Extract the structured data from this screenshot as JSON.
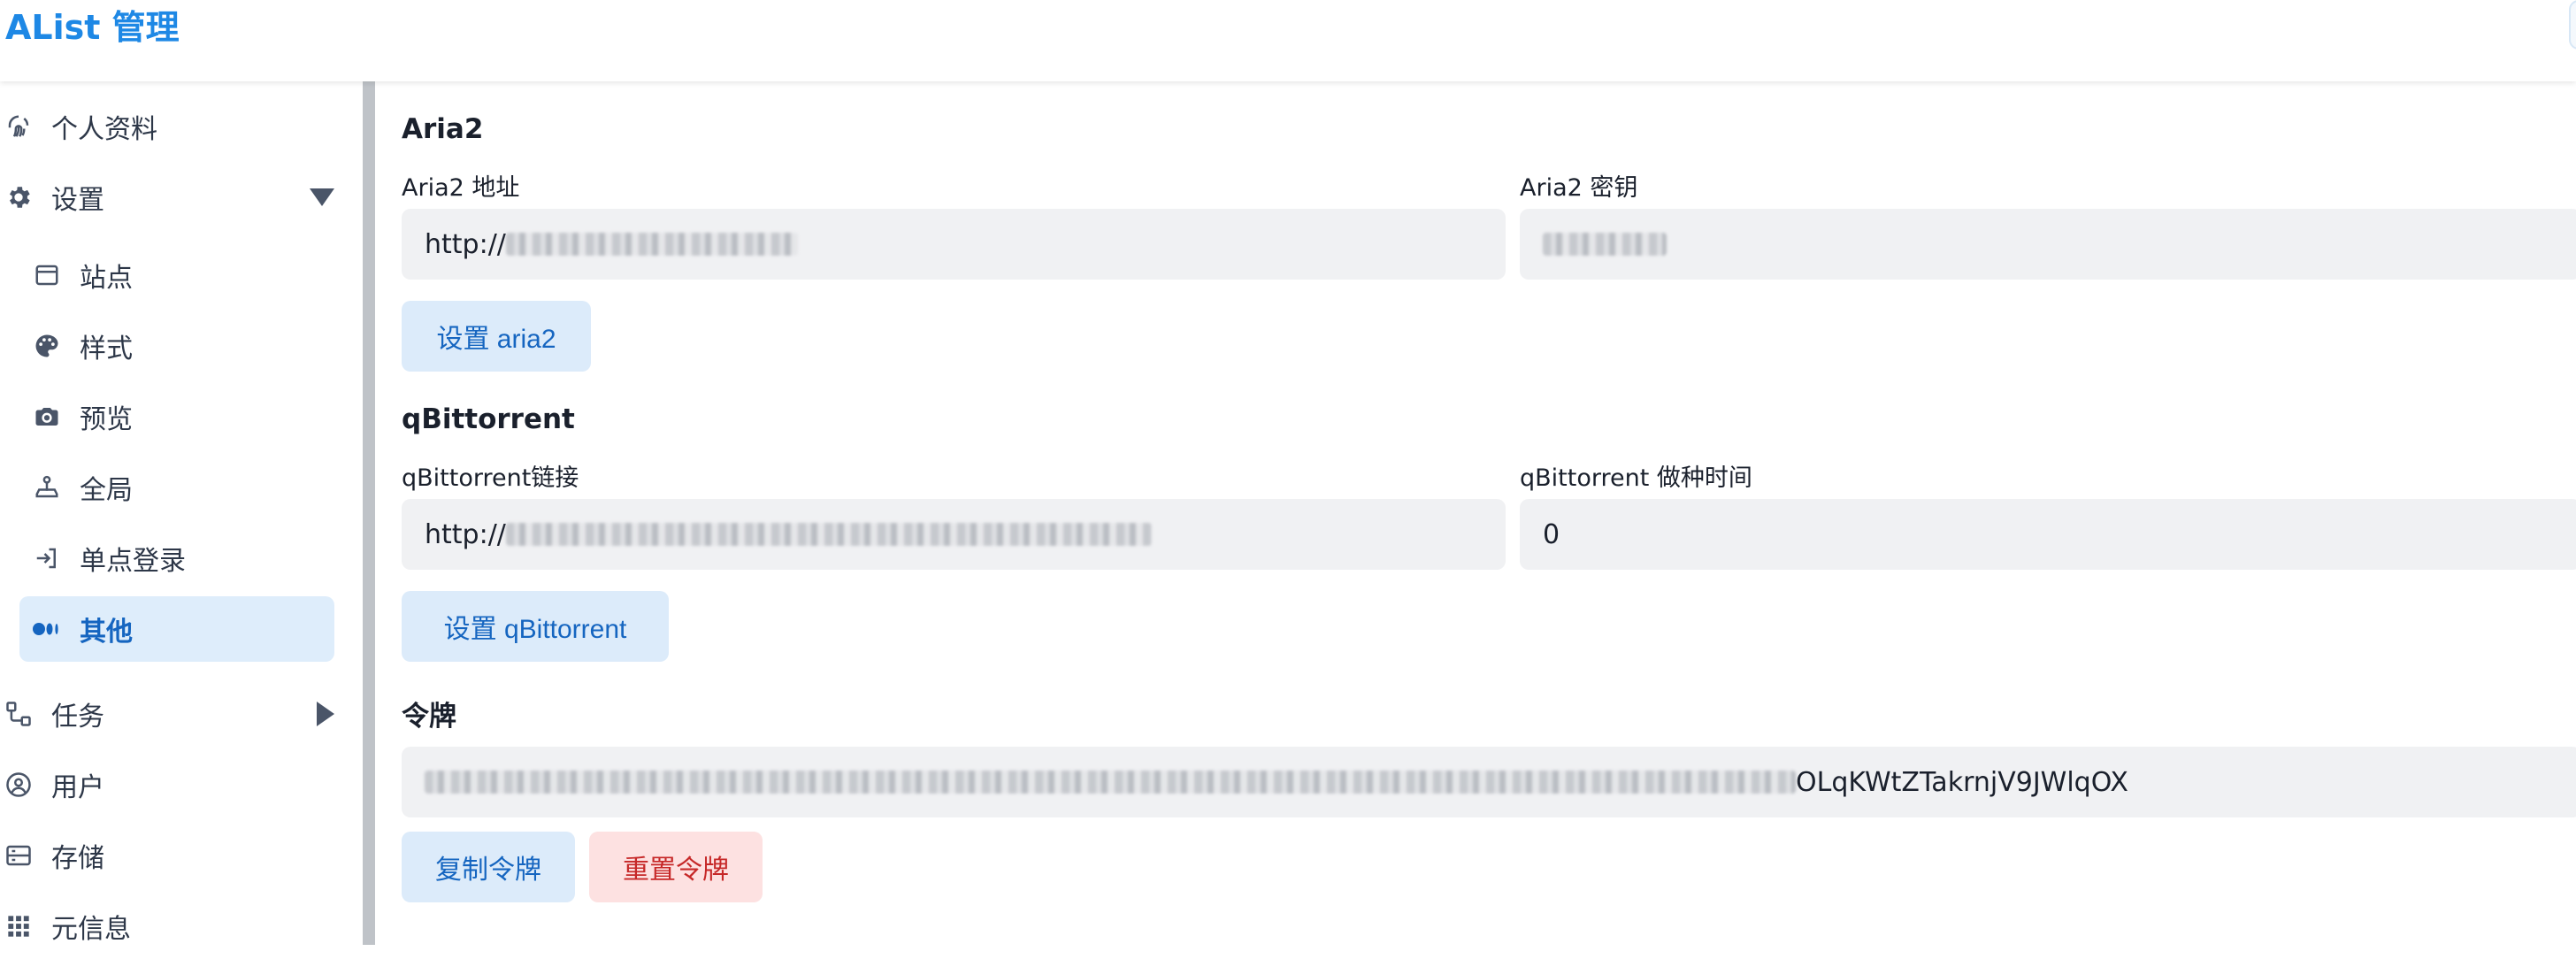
{
  "app": {
    "title": "AList 管理"
  },
  "sidebar": {
    "items": [
      {
        "label": "个人资料",
        "icon": "fingerprint-icon"
      },
      {
        "label": "设置",
        "icon": "gear-icon"
      },
      {
        "label": "站点",
        "icon": "window-icon"
      },
      {
        "label": "样式",
        "icon": "palette-icon"
      },
      {
        "label": "预览",
        "icon": "camera-icon"
      },
      {
        "label": "全局",
        "icon": "joystick-icon"
      },
      {
        "label": "单点登录",
        "icon": "login-icon"
      },
      {
        "label": "其他",
        "icon": "medium-icon"
      },
      {
        "label": "任务",
        "icon": "flow-icon"
      },
      {
        "label": "用户",
        "icon": "user-circle-icon"
      },
      {
        "label": "存储",
        "icon": "storage-icon"
      },
      {
        "label": "元信息",
        "icon": "grid-icon"
      }
    ],
    "active": "其他"
  },
  "aria2": {
    "title": "Aria2",
    "uri_label": "Aria2 地址",
    "uri_value": "http://",
    "secret_label": "Aria2 密钥",
    "button": "设置 aria2"
  },
  "qbittorrent": {
    "title": "qBittorrent",
    "url_label": "qBittorrent链接",
    "url_value": "http://",
    "seedtime_label": "qBittorrent 做种时间",
    "seedtime_value": "0",
    "button": "设置 qBittorrent"
  },
  "token": {
    "title": "令牌",
    "visible_suffix": "OLqKWtZTakrnjV9JWlqOX",
    "copy_button": "复制令牌",
    "reset_button": "重置令牌"
  },
  "colors": {
    "brand": "#1e88e5",
    "active_bg": "#deedfb",
    "button_blue_bg": "#dcebfa",
    "button_red_bg": "#fde1e1"
  }
}
